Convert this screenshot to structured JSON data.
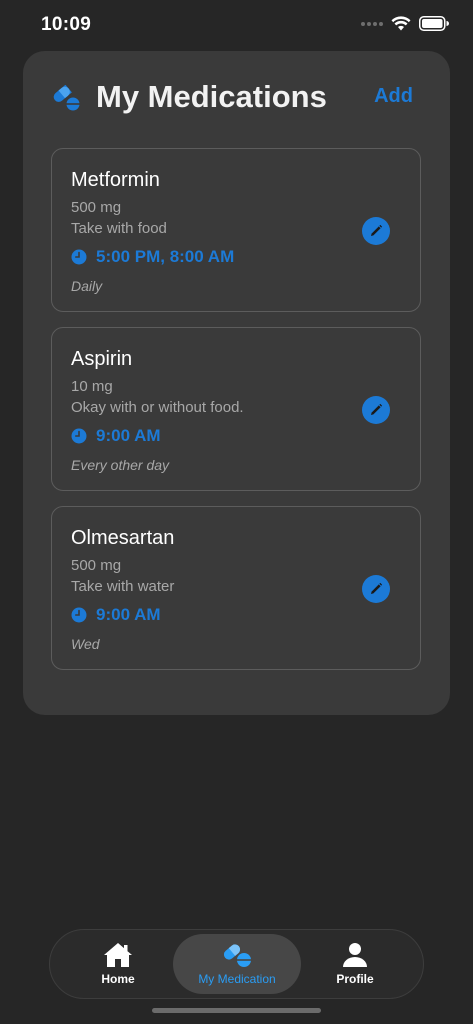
{
  "status_bar": {
    "time": "10:09",
    "icons": [
      "signal-icon",
      "wifi-icon",
      "battery-icon"
    ]
  },
  "header": {
    "icon": "pills-icon",
    "title": "My Medications",
    "add_label": "Add"
  },
  "medications": [
    {
      "name": "Metformin",
      "dose": "500 mg",
      "note": "Take with food",
      "time": "5:00 PM, 8:00 AM",
      "frequency": "Daily"
    },
    {
      "name": "Aspirin",
      "dose": "10 mg",
      "note": "Okay with or without food.",
      "time": "9:00 AM",
      "frequency": "Every other day"
    },
    {
      "name": "Olmesartan",
      "dose": "500 mg",
      "note": "Take with water",
      "time": "9:00 AM",
      "frequency": "Wed"
    }
  ],
  "tab_bar": {
    "tabs": [
      {
        "label": "Home",
        "icon": "home-icon",
        "active": false
      },
      {
        "label": "My Medication",
        "icon": "pills-icon",
        "active": true
      },
      {
        "label": "Profile",
        "icon": "person-icon",
        "active": false
      }
    ]
  },
  "colors": {
    "background": "#262626",
    "panel": "#3a3a3a",
    "accent": "#1c7ad6",
    "active_tab_accent": "#2a9df4"
  }
}
